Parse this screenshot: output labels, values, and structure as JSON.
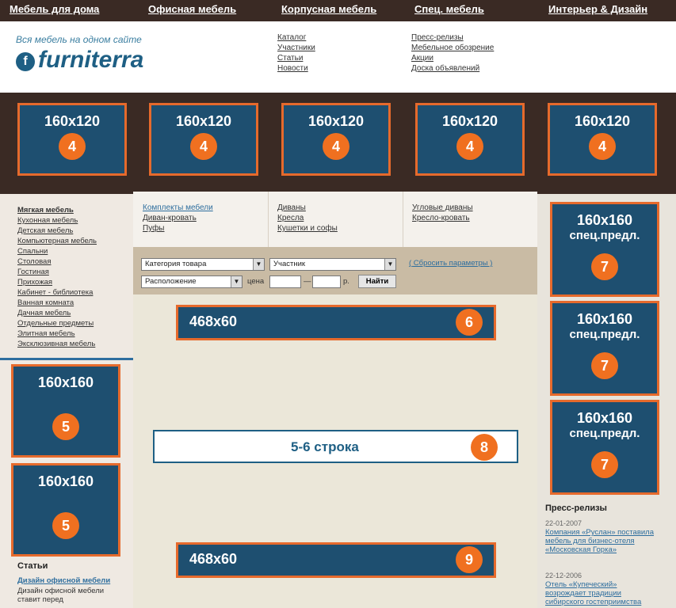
{
  "topnav": [
    "Мебель для дома",
    "Офисная мебель",
    "Корпусная мебель",
    "Спец. мебель",
    "Интерьер & Дизайн"
  ],
  "header": {
    "tagline": "Вся мебель на одном сайте",
    "logo": "furniterra",
    "col1": [
      "Каталог",
      "Участники",
      "Статьи",
      "Новости"
    ],
    "col2": [
      "Пресс-релизы",
      "Мебельное обозрение",
      "Акции",
      "Доска объявлений"
    ]
  },
  "top_banners": {
    "size": "160x120",
    "number": "4"
  },
  "left_menu": [
    "Мягкая мебель",
    "Кухонная мебель",
    "Детская мебель",
    "Компьютерная мебель",
    "Спальни",
    "Столовая",
    "Гостиная",
    "Прихожая",
    "Кабинет - библиотека",
    "Ванная комната",
    "Дачная мебель",
    "Отдельные предметы",
    "Элитная мебель",
    "Эксклюзивная мебель"
  ],
  "left_banners": {
    "size": "160x160",
    "number": "5"
  },
  "subcats": {
    "col1": [
      "Комплекты мебели",
      "Диван-кровать",
      "Пуфы"
    ],
    "col2": [
      "Диваны",
      "Кресла",
      "Кушетки и софы"
    ],
    "col3": [
      "Угловые диваны",
      "Кресло-кровать"
    ]
  },
  "filter": {
    "category": "Категория товара",
    "participant": "Участник",
    "location": "Расположение",
    "price_label": "цена",
    "dash": "—",
    "currency": "р.",
    "find": "Найти",
    "reset": "( Сбросить параметры )"
  },
  "wide_banner_top": {
    "size": "468x60",
    "number": "6"
  },
  "stroka": {
    "text": "5-6 строка",
    "number": "8"
  },
  "wide_banner_bottom": {
    "size": "468x60",
    "number": "9"
  },
  "right_banners": {
    "size": "160x160",
    "sub": "спец.предл.",
    "number": "7"
  },
  "press": {
    "title": "Пресс-релизы",
    "items": [
      {
        "date": "22-01-2007",
        "text": "Компания «Руслан» поставила мебель для бизнес-отеля «Московская Горка»"
      },
      {
        "date": "22-12-2006",
        "text": "Отель «Купеческий» возрождает традиции сибирского гостеприимства"
      }
    ]
  },
  "articles": {
    "title": "Статьи",
    "link": "Дизайн офисной мебели",
    "text": "Дизайн офисной мебели ставит перед"
  }
}
